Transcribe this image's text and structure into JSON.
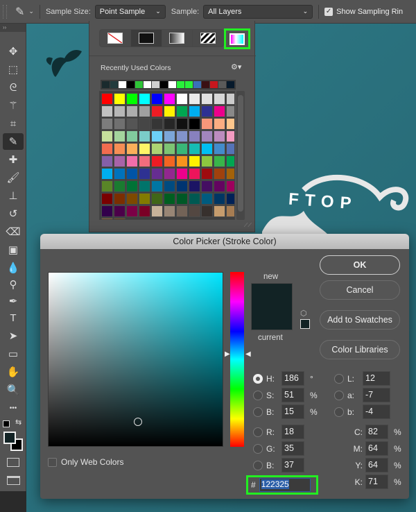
{
  "options_bar": {
    "tool_icon": "eyedropper-icon",
    "sample_size_label": "Sample Size:",
    "sample_size_value": "Point Sample",
    "sample_label": "Sample:",
    "sample_value": "All Layers",
    "show_sampling_ring_label": "Show Sampling Rin",
    "show_sampling_ring_checked": true
  },
  "toolbar": {
    "collapse": "››",
    "tools": [
      {
        "name": "move-tool",
        "glyph": "✥"
      },
      {
        "name": "marquee-tool",
        "glyph": "⬚"
      },
      {
        "name": "lasso-tool",
        "glyph": "ᘓ"
      },
      {
        "name": "magic-wand-tool",
        "glyph": "⚚"
      },
      {
        "name": "crop-tool",
        "glyph": "⌗"
      },
      {
        "name": "eyedropper-tool",
        "glyph": "✎",
        "active": true
      },
      {
        "name": "healing-brush-tool",
        "glyph": "✚"
      },
      {
        "name": "brush-tool",
        "glyph": "🖌"
      },
      {
        "name": "clone-stamp-tool",
        "glyph": "⊥"
      },
      {
        "name": "history-brush-tool",
        "glyph": "↺"
      },
      {
        "name": "eraser-tool",
        "glyph": "⌫"
      },
      {
        "name": "gradient-tool",
        "glyph": "▣"
      },
      {
        "name": "blur-tool",
        "glyph": "💧"
      },
      {
        "name": "dodge-tool",
        "glyph": "⚲"
      },
      {
        "name": "pen-tool",
        "glyph": "✒"
      },
      {
        "name": "type-tool",
        "glyph": "T"
      },
      {
        "name": "path-selection-tool",
        "glyph": "➤"
      },
      {
        "name": "rectangle-tool",
        "glyph": "▭"
      },
      {
        "name": "hand-tool",
        "glyph": "✋"
      },
      {
        "name": "zoom-tool",
        "glyph": "🔍"
      },
      {
        "name": "more-tools",
        "glyph": "•••"
      }
    ],
    "foreground_color": "#122325",
    "background_color": "#000000"
  },
  "canvas": {
    "text": "FTOP"
  },
  "swatch_popup": {
    "title": "Recently Used Colors",
    "fill_types": [
      "none",
      "solid",
      "gradient",
      "pattern"
    ],
    "recent_colors": [
      "#1a2a2d",
      "#223b3d",
      "#ffffff",
      "#000000",
      "#2ec437",
      "#ffffff",
      "#d0d0d0",
      "#000000",
      "#ffffff",
      "#28f03a",
      "#28f03a",
      "#3a70b8",
      "#3a1013",
      "#c8161d",
      "#5a5a5a",
      "#06192b"
    ],
    "swatches": [
      "#ff0000",
      "#ffff00",
      "#00ff00",
      "#00ffff",
      "#0000ff",
      "#ff00ff",
      "#ffffff",
      "#ebebeb",
      "#e1e1e1",
      "#d7d7d7",
      "#cccccc",
      "#c2c2c2",
      "#b7b7b7",
      "#adadad",
      "#a0a0a0",
      "#ed1c24",
      "#fff200",
      "#00a651",
      "#00aeef",
      "#2e3192",
      "#ec008c",
      "#898989",
      "#7d7d7d",
      "#707070",
      "#555555",
      "#464646",
      "#363636",
      "#262626",
      "#111111",
      "#000000",
      "#f7977a",
      "#fbad82",
      "#fdc68c",
      "#c6df9c",
      "#a4d49d",
      "#81ca9d",
      "#7bcdc9",
      "#6ccff7",
      "#7ca6d8",
      "#8293ca",
      "#8881be",
      "#a286bd",
      "#bc8cbf",
      "#f49bc1",
      "#f26c4f",
      "#f68e55",
      "#fbaf5a",
      "#fff467",
      "#acd372",
      "#7dc473",
      "#39b778",
      "#17bcb4",
      "#00bff3",
      "#438ccb",
      "#5573b7",
      "#8560a8",
      "#a863a8",
      "#f16eaa",
      "#f26d7d",
      "#ed1c24",
      "#f26522",
      "#f7941d",
      "#fff200",
      "#8dc63f",
      "#39b54a",
      "#00a651",
      "#00aeef",
      "#0072bc",
      "#0054a6",
      "#2e3192",
      "#662d91",
      "#92278f",
      "#ec008c",
      "#ed145b",
      "#9e0b0f",
      "#a0410d",
      "#a36209",
      "#598527",
      "#1a7b30",
      "#007236",
      "#00746b",
      "#0076a3",
      "#004b80",
      "#003471",
      "#1b1464",
      "#440e62",
      "#630460",
      "#9e005d",
      "#790000",
      "#7b2e00",
      "#7d4900",
      "#827b00",
      "#406618",
      "#005e20",
      "#005826",
      "#005952",
      "#005b7f",
      "#003663",
      "#002157",
      "#32004b",
      "#4b0049",
      "#7b0046",
      "#7a0026",
      "#c7b299",
      "#998675",
      "#736357",
      "#534741",
      "#37302d",
      "#c69c6d",
      "#a67c52",
      "#8c6239",
      "#754c24"
    ],
    "scroll_position": 0.05
  },
  "color_picker": {
    "title": "Color Picker (Stroke Color)",
    "new_label": "new",
    "current_label": "current",
    "new_color": "#122325",
    "current_color": "#122325",
    "hue_fraction": 0.48,
    "buttons": {
      "ok": "OK",
      "cancel": "Cancel",
      "add_to_swatches": "Add to Swatches",
      "color_libraries": "Color Libraries"
    },
    "only_web_colors_label": "Only Web Colors",
    "only_web_colors_checked": false,
    "hsb": [
      {
        "label": "H:",
        "value": "186",
        "unit": "°",
        "selected": true
      },
      {
        "label": "S:",
        "value": "51",
        "unit": "%",
        "selected": false
      },
      {
        "label": "B:",
        "value": "15",
        "unit": "%",
        "selected": false
      }
    ],
    "rgb": [
      {
        "label": "R:",
        "value": "18"
      },
      {
        "label": "G:",
        "value": "35"
      },
      {
        "label": "B:",
        "value": "37"
      }
    ],
    "lab": [
      {
        "label": "L:",
        "value": "12"
      },
      {
        "label": "a:",
        "value": "-7"
      },
      {
        "label": "b:",
        "value": "-4"
      }
    ],
    "cmyk": [
      {
        "label": "C:",
        "value": "82",
        "unit": "%"
      },
      {
        "label": "M:",
        "value": "64",
        "unit": "%"
      },
      {
        "label": "Y:",
        "value": "64",
        "unit": "%"
      },
      {
        "label": "K:",
        "value": "71",
        "unit": "%"
      }
    ],
    "hex_label": "#",
    "hex_value": "122325"
  }
}
